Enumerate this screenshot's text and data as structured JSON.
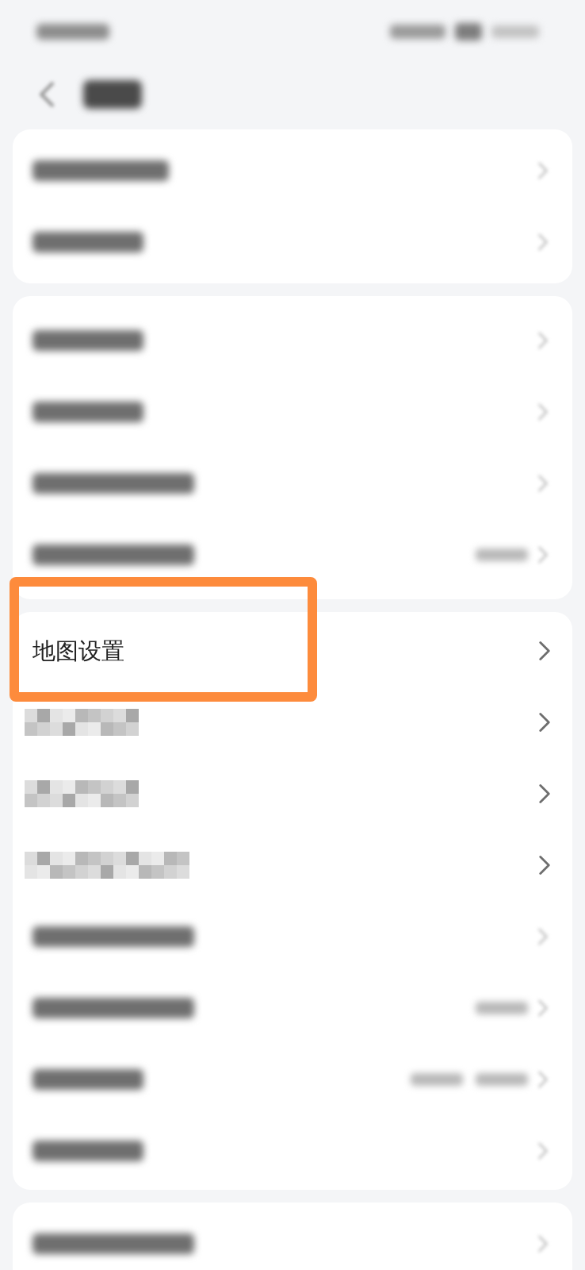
{
  "status_bar": {
    "kind": "blurred"
  },
  "header": {
    "title": {
      "kind": "blurred"
    }
  },
  "groups": [
    {
      "rows": [
        {
          "kind": "blurred",
          "label": {
            "kind": "medium"
          },
          "highlighted": false
        },
        {
          "kind": "blurred",
          "label": {
            "kind": "short"
          },
          "highlighted": false
        }
      ]
    },
    {
      "rows": [
        {
          "kind": "blurred",
          "label": {
            "kind": "short"
          },
          "highlighted": false
        },
        {
          "kind": "blurred",
          "label": {
            "kind": "short"
          },
          "highlighted": false
        },
        {
          "kind": "blurred",
          "label": {
            "kind": "long"
          },
          "highlighted": false
        },
        {
          "kind": "blurred",
          "label": {
            "kind": "long"
          },
          "highlighted": false,
          "values": [
            {
              "kind": "blurred"
            }
          ]
        }
      ]
    },
    {
      "rows": [
        {
          "kind": "text",
          "label": "地图设置",
          "highlighted": true
        },
        {
          "kind": "mosaic",
          "label": {
            "kind": "short"
          },
          "highlighted": false
        },
        {
          "kind": "mosaic",
          "label": {
            "kind": "short"
          },
          "highlighted": false
        },
        {
          "kind": "mosaic",
          "label": {
            "kind": "long"
          },
          "highlighted": false
        },
        {
          "kind": "blurred",
          "label": {
            "kind": "long"
          },
          "highlighted": false
        },
        {
          "kind": "blurred",
          "label": {
            "kind": "long"
          },
          "highlighted": false,
          "values": [
            {
              "kind": "blurred"
            }
          ]
        },
        {
          "kind": "blurred",
          "label": {
            "kind": "short"
          },
          "highlighted": false,
          "values": [
            {
              "kind": "blurred"
            },
            {
              "kind": "blurred"
            }
          ]
        },
        {
          "kind": "blurred",
          "label": {
            "kind": "short"
          },
          "highlighted": false
        }
      ]
    },
    {
      "rows": [
        {
          "kind": "blurred",
          "label": {
            "kind": "long"
          },
          "highlighted": false
        }
      ]
    }
  ]
}
